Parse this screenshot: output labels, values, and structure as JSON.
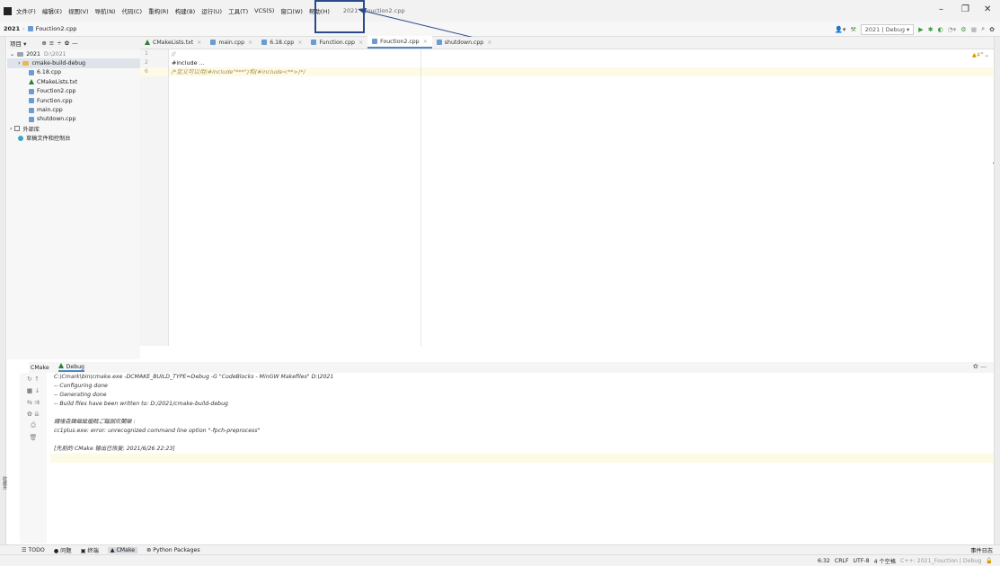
{
  "menubar": {
    "items": [
      "文件(F)",
      "编辑(E)",
      "视图(V)",
      "导航(N)",
      "代码(C)",
      "重构(R)",
      "构建(B)",
      "运行(U)",
      "工具(T)",
      "VCS(S)",
      "窗口(W)",
      "帮助(H)"
    ],
    "title": "2021 - Fouction2.cpp"
  },
  "window": {
    "minimize": "–",
    "maximize": "❐",
    "close": "✕"
  },
  "breadcrumb": {
    "project": "2021",
    "file": "Fouction2.cpp"
  },
  "toolbar": {
    "config": "2021 | Debug ▾"
  },
  "project_panel": {
    "header": "项目 ▾",
    "root": "2021",
    "root_path": "D:\\2021",
    "items": [
      "cmake-build-debug",
      "6.18.cpp",
      "CMakeLists.txt",
      "Fouction2.cpp",
      "Function.cpp",
      "main.cpp",
      "shutdown.cpp"
    ],
    "external": "外部库",
    "scratch": "草稿文件和控制台"
  },
  "tabs": [
    "CMakeLists.txt",
    "main.cpp",
    "6.18.cpp",
    "Function.cpp",
    "Fouction2.cpp",
    "shutdown.cpp"
  ],
  "editor": {
    "line_numbers": [
      "1",
      "2",
      "6"
    ],
    "lines": [
      "//",
      "#include ...",
      "/*定义可以用(#include\"***\")和(#include<**>)*/"
    ],
    "warnings": "▲4"
  },
  "console": {
    "tab1": "CMake",
    "tab2": "Debug",
    "lines": [
      "C:\\Cmark\\bin\\cmake.exe -DCMAKE_BUILD_TYPE=Debug -G \"CodeBlocks - MinGW Makefiles\" D:\\2021",
      "-- Configuring done",
      "-- Generating done",
      "-- Build files have been written to: D:/2021/cmake-build-debug",
      "",
      "鍚堟垚鍓嶇紪璇戝ご鏂囦欢閿欒    :",
      "    cc1plus.exe: error: unrecognized command line option \"-fpch-preprocess\"",
      "",
      "[先前的 CMake 输出已恢复: 2021/6/26 22:23]"
    ]
  },
  "bottom_tabs": [
    "☰ TODO",
    "● 问题",
    "▣ 终端",
    "▲ CMake",
    "⊛ Python Packages"
  ],
  "bottom_right": "事件日志",
  "status": {
    "pos": "6:32",
    "eol": "CRLF",
    "enc": "UTF-8",
    "indent": "4 个空格",
    "ctx": "C++: 2021_Fouction | Debug"
  },
  "left_vertical": "收藏夹"
}
